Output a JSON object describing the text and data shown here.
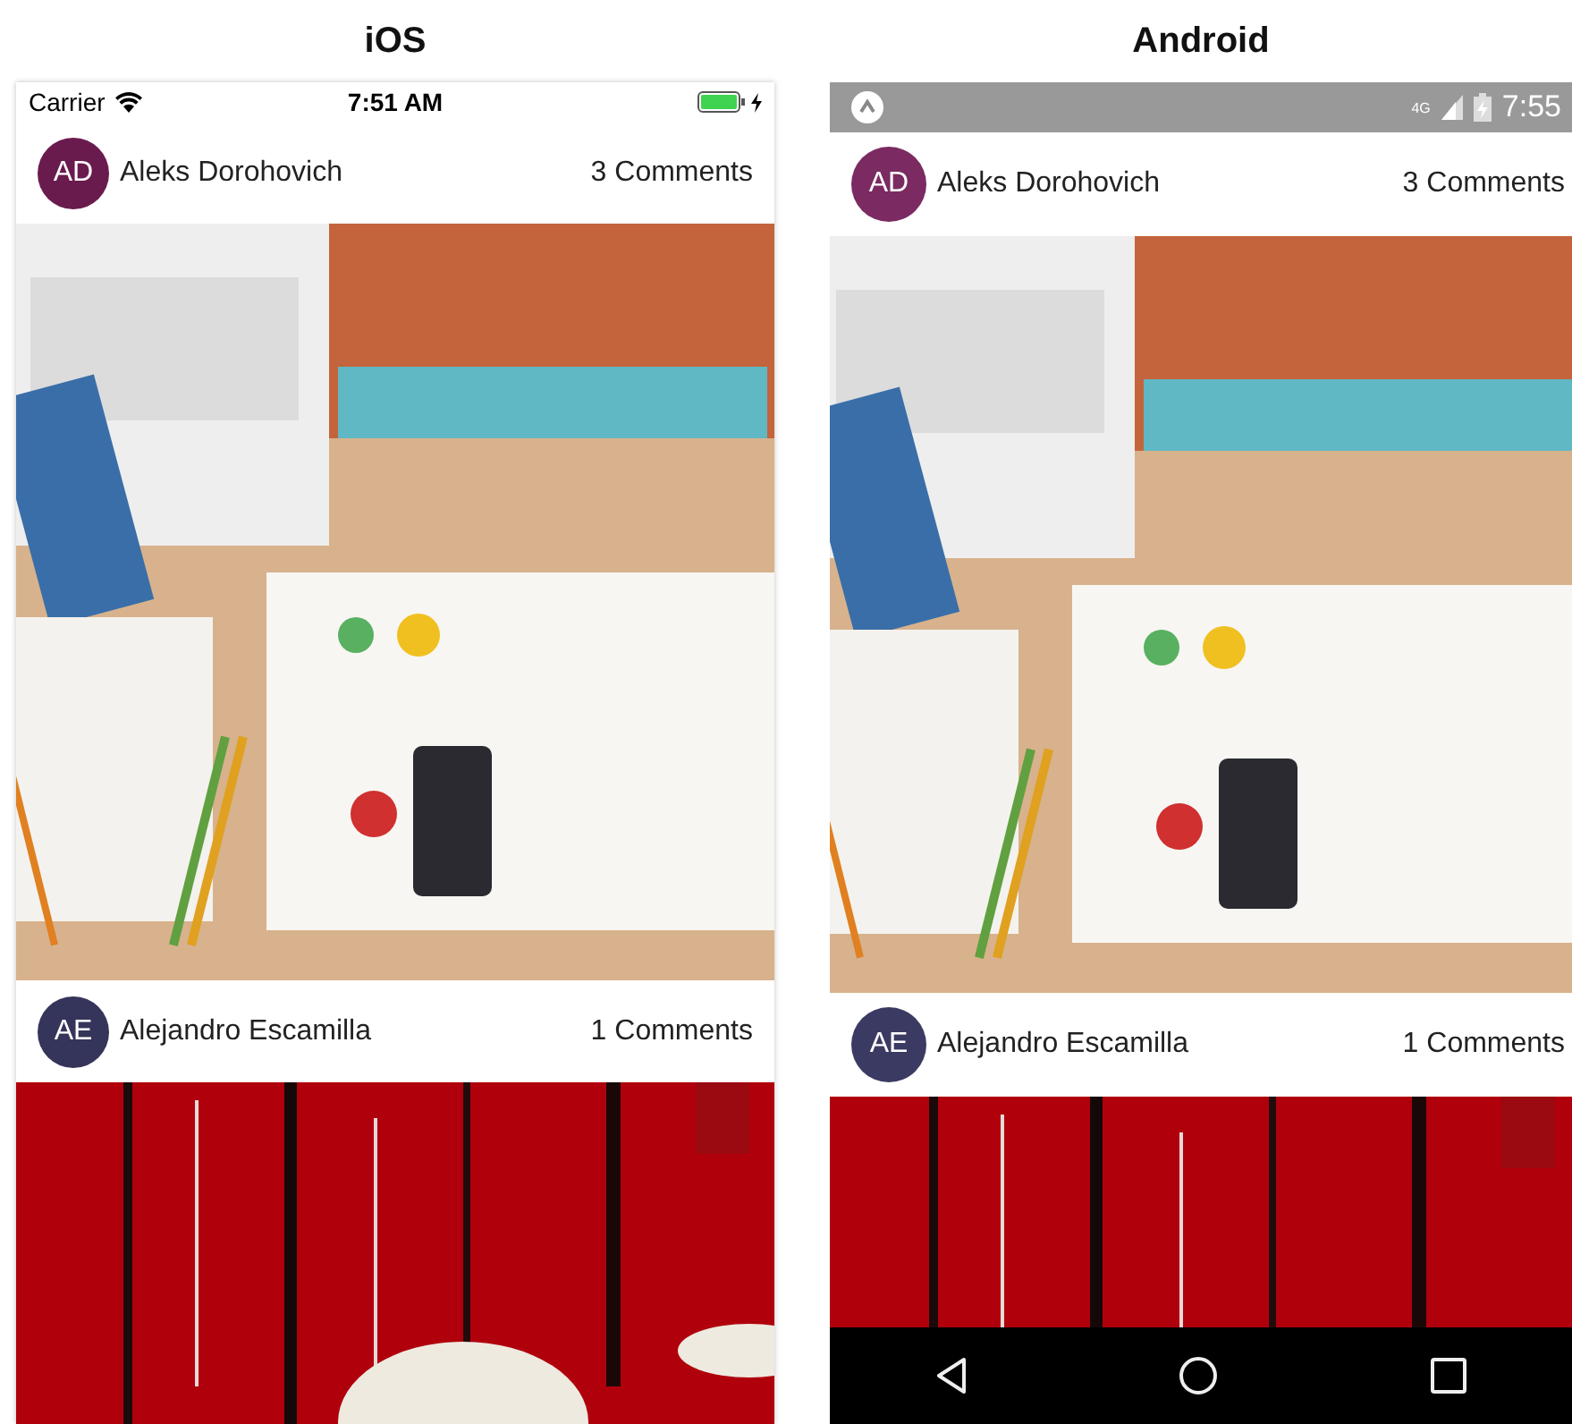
{
  "screens": [
    {
      "kind": "ios",
      "label": "iOS",
      "status": {
        "carrier": "Carrier",
        "time": "7:51 AM"
      },
      "posts": [
        {
          "initials": "AD",
          "author": "Aleks Dorohovich",
          "comments": "3 Comments",
          "color": "#6a1b4e"
        },
        {
          "initials": "AE",
          "author": "Alejandro Escamilla",
          "comments": "1 Comments",
          "color": "#35345a"
        }
      ]
    },
    {
      "kind": "android",
      "label": "Android",
      "status": {
        "network": "4G",
        "time": "7:55"
      },
      "posts": [
        {
          "initials": "AD",
          "author": "Aleks Dorohovich",
          "comments": "3 Comments",
          "color": "#7b2a62"
        },
        {
          "initials": "AE",
          "author": "Alejandro Escamilla",
          "comments": "1 Comments",
          "color": "#3b3a62"
        }
      ]
    }
  ]
}
